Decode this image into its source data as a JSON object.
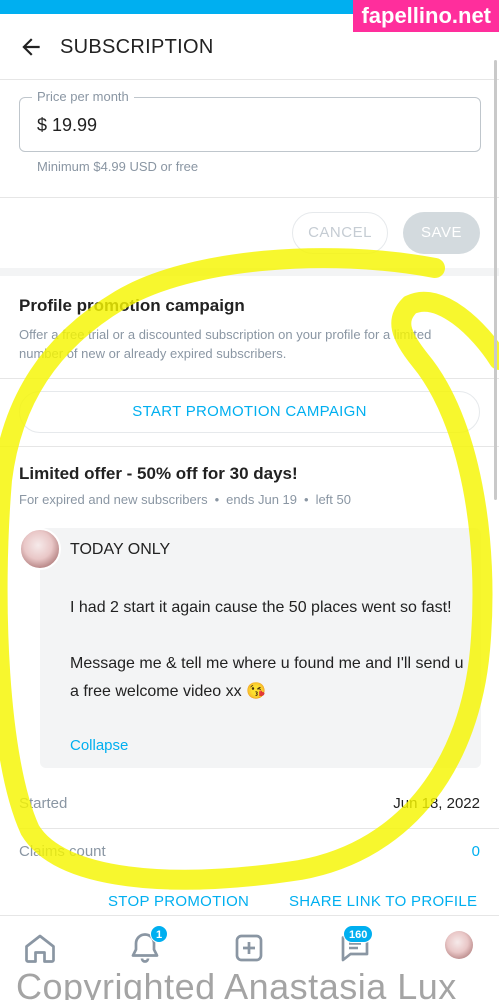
{
  "watermark_top": "fapellino.net",
  "header": {
    "title": "SUBSCRIPTION",
    "back_icon": "arrow-left-icon"
  },
  "price": {
    "label": "Price per month",
    "value": "$ 19.99",
    "hint": "Minimum $4.99 USD or free"
  },
  "actions": {
    "cancel": "CANCEL",
    "save": "SAVE"
  },
  "promotion": {
    "title": "Profile promotion campaign",
    "description": "Offer a free trial or a discounted subscription on your profile for a limited number of new or already expired subscribers.",
    "start_button": "START PROMOTION CAMPAIGN"
  },
  "offer": {
    "title": "Limited offer - 50% off for 30 days!",
    "audience": "For expired and new subscribers",
    "ends": "ends Jun 19",
    "left": "left 50",
    "message_head": "TODAY ONLY",
    "message_p1": "I had 2 start it again cause the 50 places went so fast!",
    "message_p2": "Message me & tell me where u found me and I'll send u a free welcome video xx 😘",
    "collapse": "Collapse"
  },
  "stats": {
    "started_label": "Started",
    "started_value": "Jun 18, 2022",
    "claims_label": "Claims count",
    "claims_value": "0"
  },
  "bottom_actions": {
    "stop": "STOP PROMOTION",
    "share": "SHARE LINK TO PROFILE"
  },
  "nav": {
    "notifications_badge": "1",
    "messages_badge": "160",
    "icons": [
      "home-icon",
      "bell-icon",
      "plus-square-icon",
      "chat-icon",
      "avatar"
    ]
  },
  "watermark_bottom": "Copyrighted Anastasia Lux",
  "colors": {
    "accent": "#00aff0",
    "highlight": "#f5f500",
    "watermark": "#ff2e9c"
  }
}
